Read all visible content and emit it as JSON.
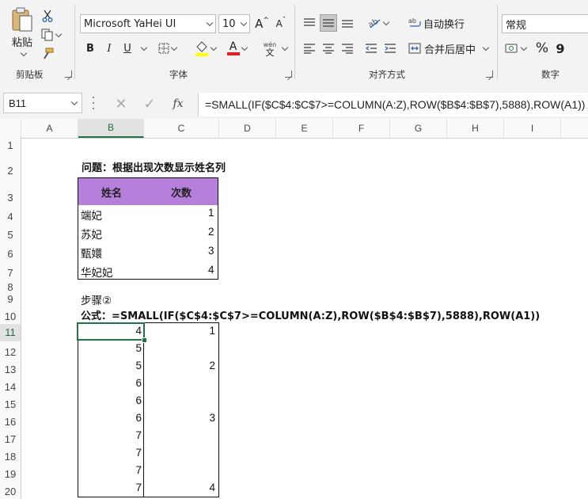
{
  "ribbon": {
    "clipboard": {
      "paste": "粘贴",
      "group": "剪贴板"
    },
    "font": {
      "name": "Microsoft YaHei UI",
      "size": "10",
      "bold": "B",
      "italic": "I",
      "underline": "U",
      "grow": "A",
      "shrink": "A",
      "color_a": "A",
      "phonetic_top": "wén",
      "phonetic_bottom": "文",
      "group": "字体"
    },
    "alignment": {
      "wrap": "自动换行",
      "merge": "合并后居中",
      "group": "对齐方式"
    },
    "number": {
      "format": "常规",
      "percent": "%",
      "comma": "9",
      "group": "数字"
    }
  },
  "formula_bar": {
    "name_box": "B11",
    "fx": "fx",
    "formula": "=SMALL(IF($C$4:$C$7>=COLUMN(A:Z),ROW($B$4:$B$7),5888),ROW(A1))"
  },
  "columns": [
    "A",
    "B",
    "C",
    "D",
    "E",
    "F",
    "G",
    "H",
    "I"
  ],
  "rows": [
    "1",
    "2",
    "3",
    "4",
    "5",
    "6",
    "7",
    "8",
    "9",
    "10",
    "11",
    "12",
    "13",
    "14",
    "15",
    "16",
    "17",
    "18",
    "19",
    "20"
  ],
  "sheet": {
    "question": "问题：根据出现次数显示姓名列",
    "table_headers": [
      "姓名",
      "次数"
    ],
    "table_rows": [
      {
        "name": "端妃",
        "count": "1"
      },
      {
        "name": "苏妃",
        "count": "2"
      },
      {
        "name": "甄嬛",
        "count": "3"
      },
      {
        "name": "华妃妃",
        "count": "4"
      }
    ],
    "step": "步骤②",
    "formula_label": "公式：=SMALL(IF($C$4:$C$7>=COLUMN(A:Z),ROW($B$4:$B$7),5888),ROW(A1))",
    "result_b": [
      "4",
      "5",
      "5",
      "6",
      "6",
      "6",
      "7",
      "7",
      "7",
      "7"
    ],
    "result_c": [
      "1",
      "",
      "2",
      "",
      "",
      "3",
      "",
      "",
      "",
      "4"
    ]
  },
  "colors": {
    "header_fill": "#b67fdc",
    "selection": "#217346"
  }
}
